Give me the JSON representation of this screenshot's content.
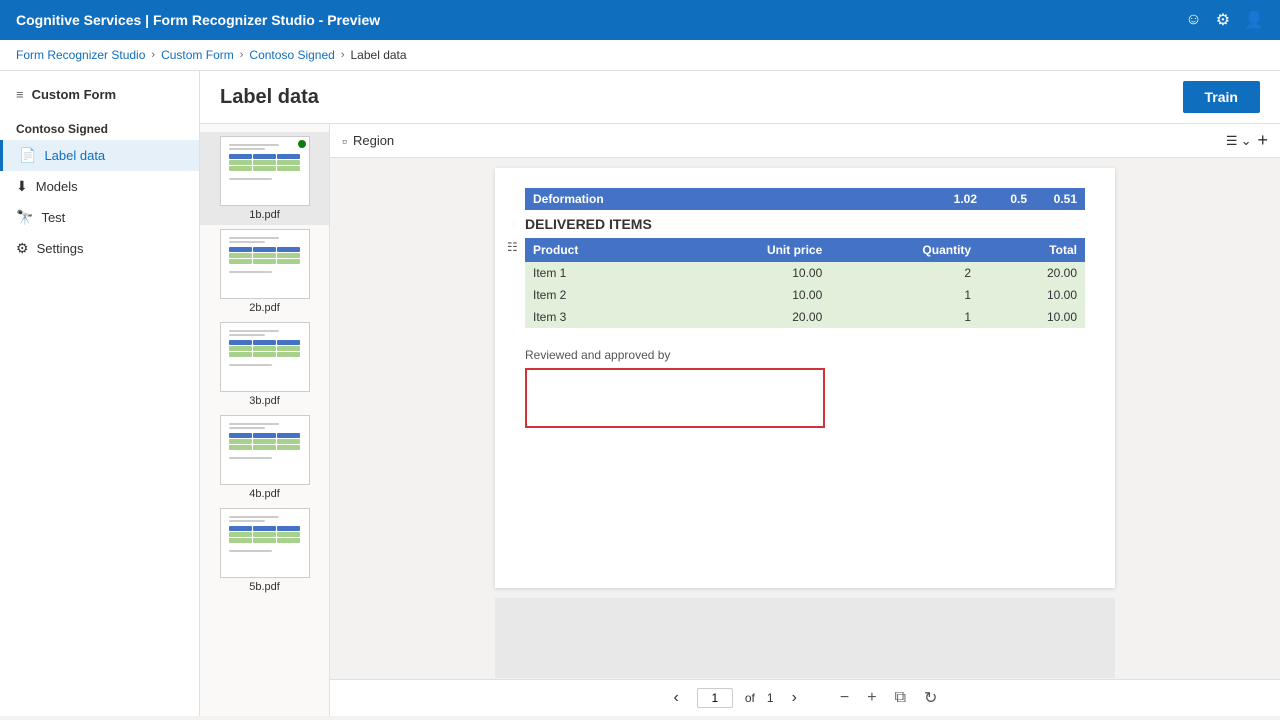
{
  "topbar": {
    "title": "Cognitive Services | Form Recognizer Studio - Preview",
    "icons": [
      "smiley",
      "settings",
      "user"
    ]
  },
  "breadcrumb": {
    "items": [
      "Form Recognizer Studio",
      "Custom Form",
      "Contoso Signed",
      "Label data"
    ]
  },
  "sidebar": {
    "toggle_label": "≡",
    "app_label": "Custom Form",
    "section": "Contoso Signed",
    "items": [
      {
        "id": "label-data",
        "label": "Label data",
        "icon": "📄",
        "active": true
      },
      {
        "id": "models",
        "label": "Models",
        "icon": "⬡"
      },
      {
        "id": "test",
        "label": "Test",
        "icon": "🧪"
      },
      {
        "id": "settings",
        "label": "Settings",
        "icon": "⚙"
      }
    ]
  },
  "page": {
    "title": "Label data",
    "train_button": "Train"
  },
  "toolbar": {
    "region_label": "Region",
    "add_button": "+",
    "layers_icon": "layers"
  },
  "files": [
    {
      "name": "1b.pdf",
      "active": true,
      "has_dot": true
    },
    {
      "name": "2b.pdf",
      "active": false,
      "has_dot": false
    },
    {
      "name": "3b.pdf",
      "active": false,
      "has_dot": false
    },
    {
      "name": "4b.pdf",
      "active": false,
      "has_dot": false
    },
    {
      "name": "5b.pdf",
      "active": false,
      "has_dot": false
    }
  ],
  "document": {
    "deformation": {
      "label": "Deformation",
      "val1": "1.02",
      "val2": "0.5",
      "val3": "0.51"
    },
    "delivered_items_title": "DELIVERED ITEMS",
    "table_headers": [
      "Product",
      "Unit price",
      "Quantity",
      "Total"
    ],
    "table_rows": [
      [
        "Item 1",
        "10.00",
        "2",
        "20.00"
      ],
      [
        "Item 2",
        "10.00",
        "1",
        "10.00"
      ],
      [
        "Item 3",
        "20.00",
        "1",
        "10.00"
      ]
    ],
    "reviewed_label": "Reviewed and approved by"
  },
  "pagination": {
    "current_page": "1",
    "total_pages": "1",
    "of_label": "of"
  }
}
